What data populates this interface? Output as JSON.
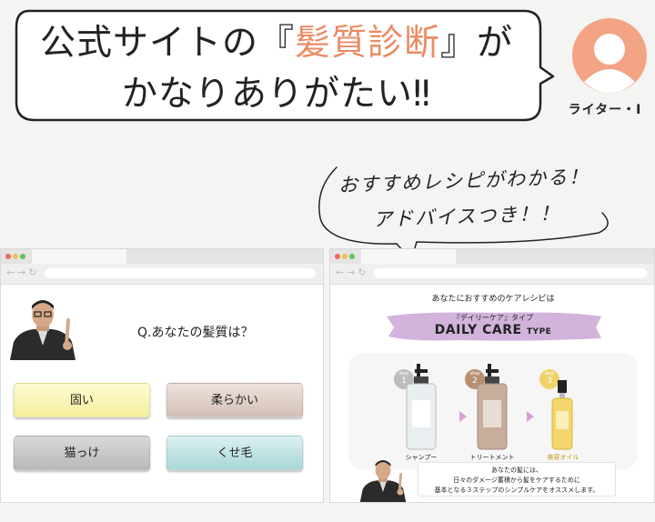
{
  "header": {
    "title_line1_before": "公式サイトの『",
    "title_line1_accent": "髪質診断",
    "title_line1_after": "』が",
    "title_line2": "かなりありがたい‼︎"
  },
  "writer": {
    "label": "ライター・I",
    "avatar_icon": "person-avatar-icon"
  },
  "comment": {
    "line1": "おすすめレシピがわかる！",
    "line2": "アドバイスつき！！"
  },
  "colors": {
    "accent": "#eb8b64",
    "avatar_bg": "#f2a484"
  },
  "diagnosis_page": {
    "question": "Q.あなたの髪質は？",
    "answers": [
      "固い",
      "柔らかい",
      "猫っけ",
      "くせ毛"
    ]
  },
  "result_page": {
    "heading": "あなたにおすすめのケアレシピは",
    "type_jp": "『デイリーケア』タイプ",
    "type_en": "DAILY CARE",
    "type_suffix": "TYPE",
    "steps": [
      {
        "word": "step",
        "num": "1",
        "label": "シャンプー"
      },
      {
        "word": "step",
        "num": "2",
        "label": "トリートメント"
      },
      {
        "word": "step",
        "num": "3",
        "label": "美容オイル"
      }
    ],
    "description_lines": [
      "あなたの髪には、",
      "日々のダメージ蓄積から髪をケアするために",
      "基本となる３ステップのシンプルケアをオススメします。"
    ]
  }
}
